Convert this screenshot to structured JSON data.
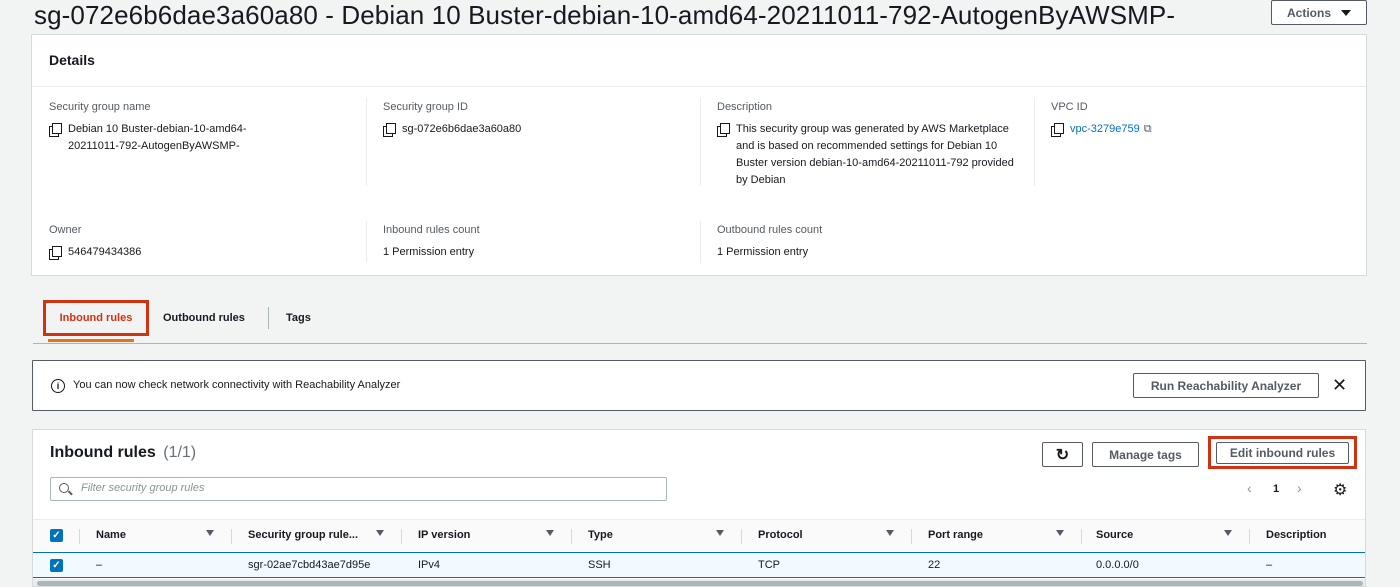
{
  "header": {
    "title": "sg-072e6b6dae3a60a80 - Debian 10 Buster-debian-10-amd64-20211011-792-AutogenByAWSMP-",
    "actions_label": "Actions"
  },
  "details": {
    "heading": "Details",
    "fields": {
      "sg_name": {
        "label": "Security group name",
        "value": "Debian 10 Buster-debian-10-amd64-20211011-792-AutogenByAWSMP-"
      },
      "sg_id": {
        "label": "Security group ID",
        "value": "sg-072e6b6dae3a60a80"
      },
      "description": {
        "label": "Description",
        "value": "This security group was generated by AWS Marketplace and is based on recommended settings for Debian 10 Buster version debian-10-amd64-20211011-792 provided by Debian"
      },
      "vpc_id": {
        "label": "VPC ID",
        "value": "vpc-3279e759"
      },
      "owner": {
        "label": "Owner",
        "value": "546479434386"
      },
      "inbound_count": {
        "label": "Inbound rules count",
        "value": "1 Permission entry"
      },
      "outbound_count": {
        "label": "Outbound rules count",
        "value": "1 Permission entry"
      }
    }
  },
  "tabs": [
    {
      "label": "Inbound rules",
      "active": true
    },
    {
      "label": "Outbound rules",
      "active": false
    },
    {
      "label": "Tags",
      "active": false
    }
  ],
  "flash": {
    "message": "You can now check network connectivity with Reachability Analyzer",
    "button_label": "Run Reachability Analyzer",
    "info_glyph": "i",
    "close_glyph": "✕"
  },
  "inbound": {
    "title": "Inbound rules",
    "count": "(1/1)",
    "refresh_glyph": "↻",
    "manage_tags_label": "Manage tags",
    "edit_label": "Edit inbound rules",
    "search_placeholder": "Filter security group rules",
    "page": "1",
    "prev_glyph": "‹",
    "next_glyph": "›",
    "gear_glyph": "⚙",
    "check_glyph": "✓",
    "columns": [
      "Name",
      "Security group rule...",
      "IP version",
      "Type",
      "Protocol",
      "Port range",
      "Source",
      "Description"
    ],
    "rows": [
      {
        "name": "–",
        "rule_id": "sgr-02ae7cbd43ae7d95e",
        "ip_version": "IPv4",
        "type": "SSH",
        "protocol": "TCP",
        "port_range": "22",
        "source": "0.0.0.0/0",
        "description": "–"
      }
    ]
  },
  "colors": {
    "accent": "#0073bb",
    "highlight_box": "#d13212",
    "active_tab": "#ec7211"
  }
}
